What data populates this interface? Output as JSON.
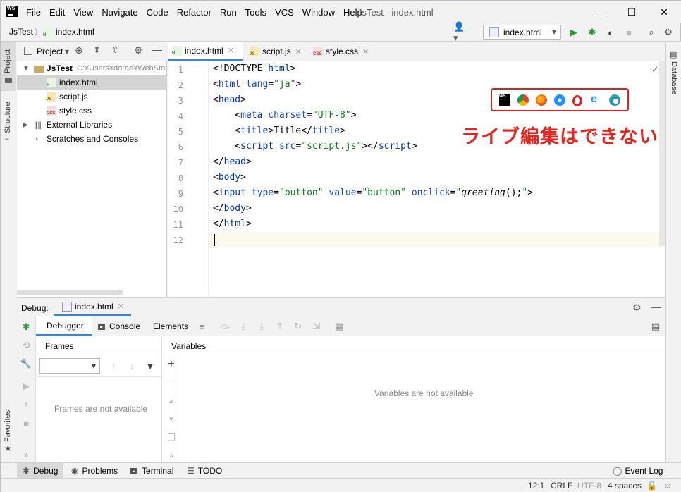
{
  "window": {
    "title": "JsTest - index.html",
    "logo": "WS",
    "minimize": "—",
    "maximize": "☐",
    "close": "✕"
  },
  "menu": [
    "File",
    "Edit",
    "View",
    "Navigate",
    "Code",
    "Refactor",
    "Run",
    "Tools",
    "VCS",
    "Window",
    "Help"
  ],
  "nav": {
    "project": "JsTest",
    "file": "index.html",
    "run_config": "index.html"
  },
  "left_stripe": {
    "project": "Project",
    "structure": "Structure",
    "favorites": "Favorites"
  },
  "right_stripe": {
    "database": "Database"
  },
  "project": {
    "header": "Project",
    "root": "JsTest",
    "root_path": "C:¥Users¥dorae¥WebStorm",
    "files": [
      "index.html",
      "script.js",
      "style.css"
    ],
    "external": "External Libraries",
    "scratches": "Scratches and Consoles"
  },
  "tabs": [
    {
      "label": "index.html"
    },
    {
      "label": "script.js"
    },
    {
      "label": "style.css"
    }
  ],
  "editor": {
    "line_numbers": [
      "1",
      "2",
      "3",
      "4",
      "5",
      "6",
      "7",
      "8",
      "9",
      "10",
      "11",
      "12"
    ]
  },
  "browser_icons": [
    "webstorm-icon",
    "chrome-icon",
    "firefox-icon",
    "safari-icon",
    "opera-icon",
    "ie-icon",
    "edge-icon"
  ],
  "callout": "ライブ編集はできない",
  "debug": {
    "label": "Debug:",
    "tab": "index.html",
    "tabs": [
      "Debugger",
      "Console",
      "Elements"
    ],
    "frames": "Frames",
    "variables": "Variables",
    "frames_empty": "Frames are not available",
    "variables_empty": "Variables are not available"
  },
  "bottom_tabs": [
    "Debug",
    "Problems",
    "Terminal",
    "TODO"
  ],
  "event_log": "Event Log",
  "status": {
    "position": "12:1",
    "line_sep": "CRLF",
    "encoding": "UTF-8",
    "indent": "4 spaces"
  },
  "colors": {
    "accent_red": "#e8231e",
    "run_green": "#2d9d3a"
  }
}
